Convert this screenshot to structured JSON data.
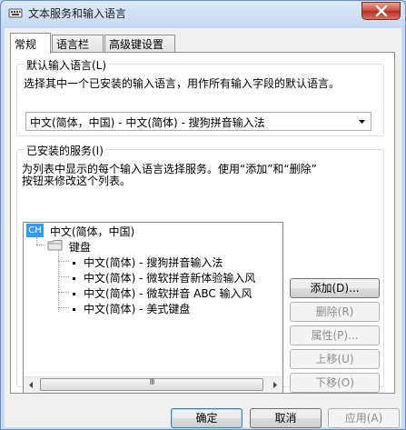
{
  "window": {
    "title": "文本服务和输入语言"
  },
  "tabs": [
    {
      "label": "常规",
      "active": true
    },
    {
      "label": "语言栏",
      "active": false
    },
    {
      "label": "高级键设置",
      "active": false
    }
  ],
  "default_language": {
    "group_title": "默认输入语言(L)",
    "description": "选择其中一个已安装的输入语言，用作所有输入字段的默认语言。",
    "selected": "中文(简体，中国) - 中文(简体) - 搜狗拼音输入法"
  },
  "installed_services": {
    "group_title": "已安装的服务(I)",
    "description_line1": "为列表中显示的每个输入语言选择服务。使用“添加”和“删除”",
    "description_line2": "按钮来修改这个列表。",
    "tree": {
      "language_badge": "CH",
      "language": "中文(简体，中国)",
      "category": "键盘",
      "items": [
        "中文(简体) - 搜狗拼音输入法",
        "中文(简体) - 微软拼音新体验输入风",
        "中文(简体) - 微软拼音 ABC 输入风",
        "中文(简体) - 美式键盘"
      ]
    },
    "scroll_thumb_grip": "III",
    "buttons": {
      "add": "添加(D)...",
      "remove": "删除(R)",
      "properties": "属性(P)...",
      "move_up": "上移(U)",
      "move_down": "下移(O)"
    }
  },
  "footer": {
    "ok": "确定",
    "cancel": "取消",
    "apply": "应用(A)"
  },
  "colors": {
    "selection_badge": "#3399ff",
    "close_button": "#c9463a",
    "title_bar": "#c6dbf3"
  }
}
